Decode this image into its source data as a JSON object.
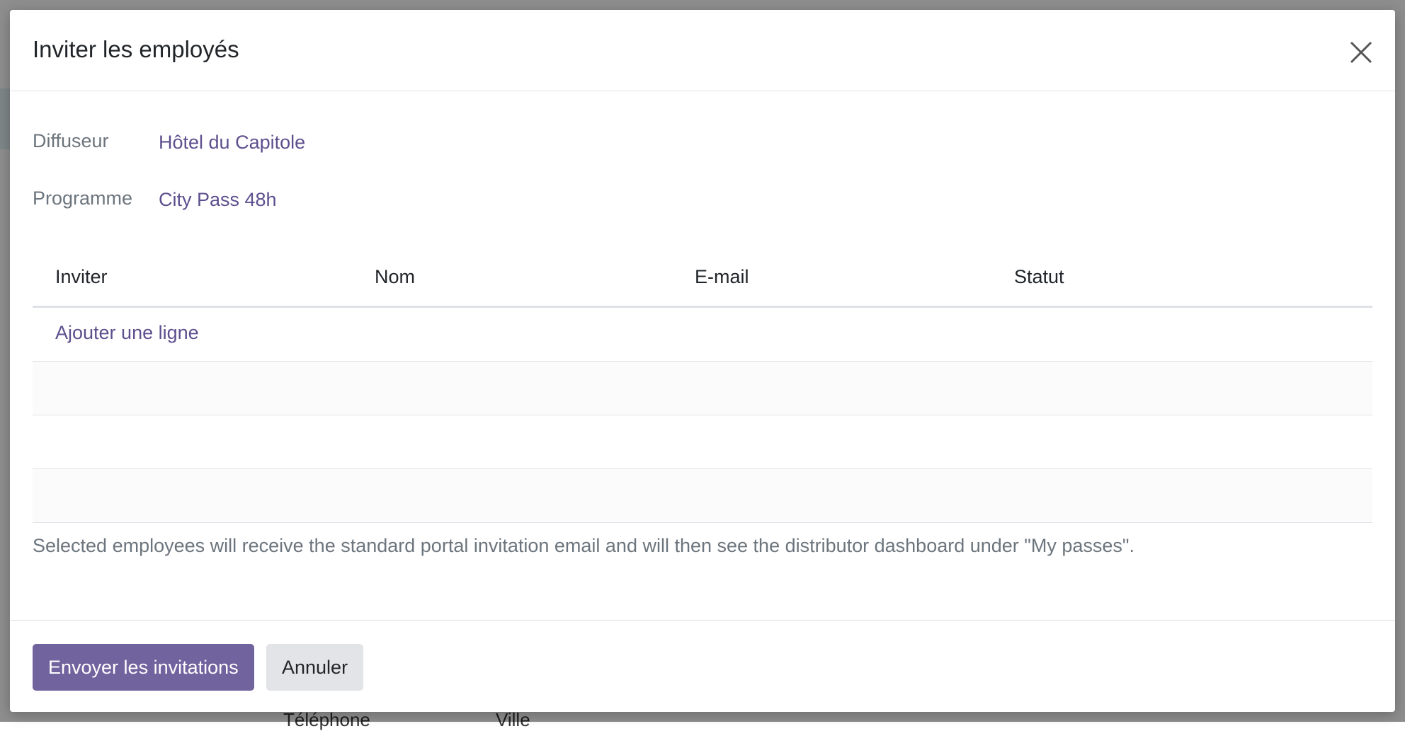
{
  "background": {
    "fragments": [
      "Téléphone",
      "Ville"
    ]
  },
  "dialog": {
    "title": "Inviter les employés",
    "close_icon": "close-icon",
    "fields": [
      {
        "label": "Diffuseur",
        "value": "Hôtel du Capitole"
      },
      {
        "label": "Programme",
        "value": "City Pass 48h"
      }
    ],
    "table": {
      "columns": [
        "Inviter",
        "Nom",
        "E-mail",
        "Statut"
      ],
      "add_line_label": "Ajouter une ligne",
      "rows": []
    },
    "help_text": "Selected employees will receive the standard portal invitation email and will then see the distributor dashboard under \"My passes\".",
    "footer": {
      "primary_label": "Envoyer les invitations",
      "secondary_label": "Annuler"
    }
  },
  "colors": {
    "accent": "#71639e",
    "link": "#5e4f8e",
    "muted": "#6c757d"
  }
}
